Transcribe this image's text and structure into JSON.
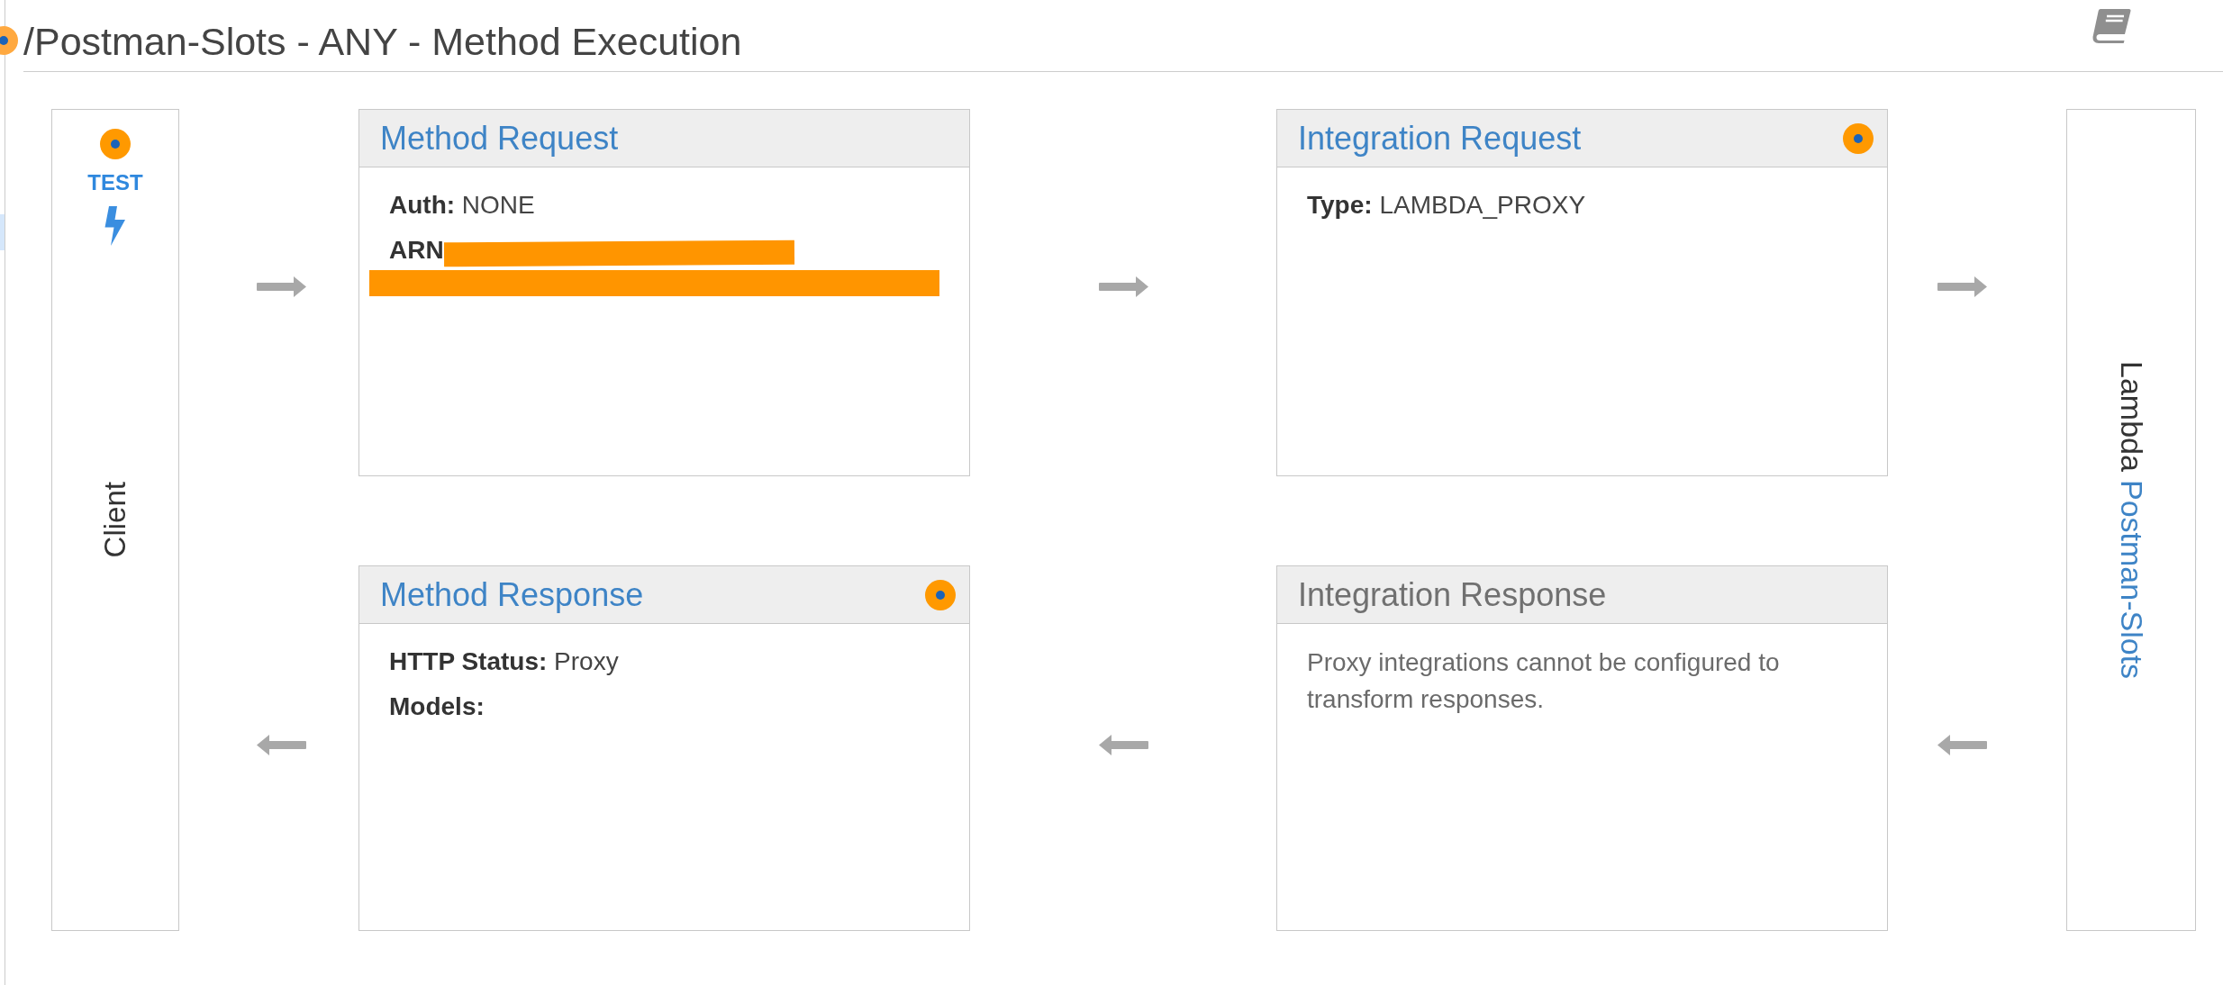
{
  "page": {
    "title": "/Postman-Slots - ANY - Method Execution",
    "marked": true
  },
  "client": {
    "marked": true,
    "test_link": "TEST",
    "label": "Client"
  },
  "cards": [
    {
      "title": "Method Request",
      "disabled": false,
      "marked": false,
      "lines": [
        {
          "kind": "field",
          "text": "**Auth:** NONE"
        },
        {
          "kind": "redacted",
          "label": "ARN"
        }
      ]
    },
    {
      "title": "Integration Request",
      "disabled": false,
      "marked": true,
      "lines": [
        {
          "kind": "field",
          "text": "**Type:** LAMBDA_PROXY"
        }
      ]
    },
    {
      "title": "Method Response",
      "disabled": false,
      "marked": true,
      "lines": [
        {
          "kind": "field",
          "text": "**HTTP Status:** Proxy"
        },
        {
          "kind": "label",
          "text": "Models:"
        }
      ]
    },
    {
      "title": "Integration Response",
      "disabled": true,
      "marked": false,
      "lines": [
        {
          "kind": "note",
          "text": "Proxy integrations cannot be configured to transform responses."
        }
      ]
    }
  ],
  "lambda": {
    "label": "Lambda",
    "function": "Postman-Slots"
  }
}
